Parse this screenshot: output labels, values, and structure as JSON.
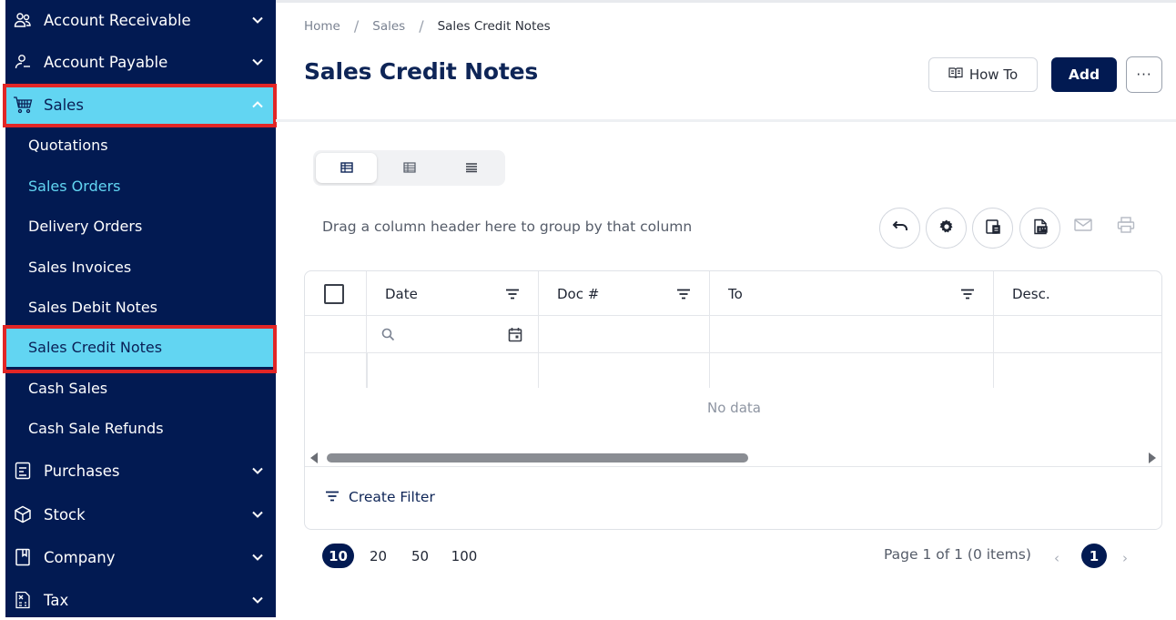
{
  "sidebar": {
    "groups_top": [
      {
        "label": "Account Receivable",
        "icon": "account-receivable-icon"
      },
      {
        "label": "Account Payable",
        "icon": "account-payable-icon"
      },
      {
        "label": "Sales",
        "icon": "sales-cart-icon"
      }
    ],
    "sales_items": [
      {
        "label": "Quotations"
      },
      {
        "label": "Sales Orders"
      },
      {
        "label": "Delivery Orders"
      },
      {
        "label": "Sales Invoices"
      },
      {
        "label": "Sales Debit Notes"
      },
      {
        "label": "Sales Credit Notes"
      },
      {
        "label": "Cash Sales"
      },
      {
        "label": "Cash Sale Refunds"
      }
    ],
    "groups_bottom": [
      {
        "label": "Purchases",
        "icon": "purchases-icon"
      },
      {
        "label": "Stock",
        "icon": "stock-box-icon"
      },
      {
        "label": "Company",
        "icon": "company-book-icon"
      },
      {
        "label": "Tax",
        "icon": "tax-calculator-icon"
      }
    ],
    "colors": {
      "background": "#021a52",
      "active": "#62d5f2",
      "highlight_border": "#e22626"
    }
  },
  "breadcrumb": {
    "items": [
      "Home",
      "Sales",
      "Sales Credit Notes"
    ],
    "separator": "/"
  },
  "header": {
    "title": "Sales Credit Notes",
    "how_to_label": "How To",
    "add_label": "Add",
    "more_label": "···"
  },
  "toolbar": {
    "group_hint": "Drag a column header here to group by that column",
    "icons": [
      "undo-icon",
      "settings-gear-icon",
      "export-excel-icon",
      "export-pdf-icon",
      "email-icon",
      "print-icon"
    ]
  },
  "grid": {
    "columns": [
      "Date",
      "Doc #",
      "To",
      "Desc."
    ],
    "empty_text": "No data",
    "create_filter_label": "Create Filter"
  },
  "pager": {
    "sizes": [
      "10",
      "20",
      "50",
      "100"
    ],
    "active_size": "10",
    "info": "Page 1 of 1 (0 items)",
    "prev": "‹",
    "next": "›",
    "current_page": "1"
  }
}
